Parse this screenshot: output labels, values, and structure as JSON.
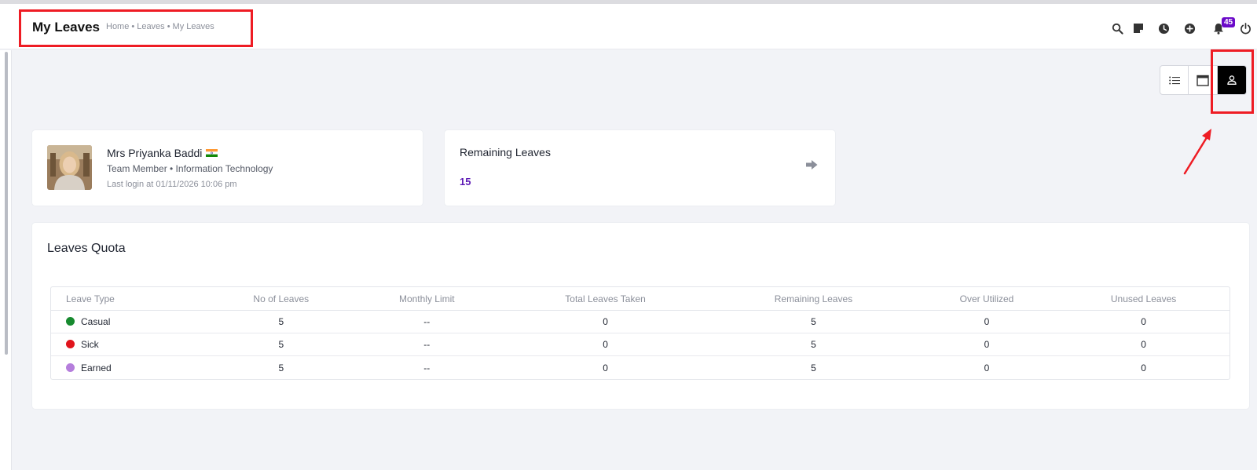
{
  "header": {
    "title": "My Leaves",
    "breadcrumb": [
      "Home",
      "Leaves",
      "My Leaves"
    ],
    "breadcrumb_sep": "•",
    "notification_count": "45",
    "icons": [
      "search-icon",
      "sticky-note-icon",
      "clock-icon",
      "plus-circle-icon",
      "bell-icon",
      "power-icon"
    ]
  },
  "view_toggle": {
    "options": [
      "list-view-icon",
      "calendar-view-icon",
      "profile-view-icon"
    ],
    "active": "profile-view-icon"
  },
  "profile": {
    "name": "Mrs Priyanka Baddi",
    "role": "Team Member • Information Technology",
    "last_login": "Last login at 01/11/2026 10:06 pm",
    "flag": "india-flag-icon"
  },
  "remaining": {
    "title": "Remaining Leaves",
    "value": "15",
    "icon": "sign-out-icon"
  },
  "quota": {
    "title": "Leaves Quota",
    "columns": [
      "Leave Type",
      "No of Leaves",
      "Monthly Limit",
      "Total Leaves Taken",
      "Remaining Leaves",
      "Over Utilized",
      "Unused Leaves"
    ],
    "rows": [
      {
        "type": "Casual",
        "color": "#178a2f",
        "no_of_leaves": "5",
        "monthly_limit": "--",
        "taken": "0",
        "remaining": "5",
        "over": "0",
        "unused": "0"
      },
      {
        "type": "Sick",
        "color": "#e1141c",
        "no_of_leaves": "5",
        "monthly_limit": "--",
        "taken": "0",
        "remaining": "5",
        "over": "0",
        "unused": "0"
      },
      {
        "type": "Earned",
        "color": "#b57edc",
        "no_of_leaves": "5",
        "monthly_limit": "--",
        "taken": "0",
        "remaining": "5",
        "over": "0",
        "unused": "0"
      }
    ]
  },
  "colors": {
    "accent": "#5b16b4",
    "badge": "#6b0ac9",
    "annotation": "#ee1c24"
  }
}
